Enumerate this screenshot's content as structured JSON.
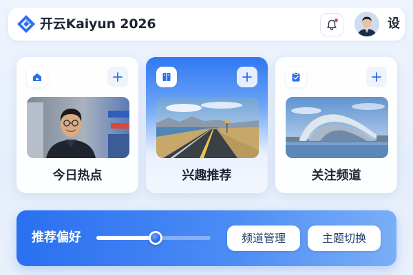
{
  "header": {
    "app_title": "开云Kaiyun 2026",
    "settings_label": "设",
    "notification_icon": "bell-icon",
    "logo_icon": "diamond-logo-icon"
  },
  "cards": [
    {
      "label": "今日热点",
      "icon": "home-icon",
      "add_icon": "plus-icon",
      "image": "portrait-photo",
      "active": false
    },
    {
      "label": "兴趣推荐",
      "icon": "book-icon",
      "add_icon": "plus-icon",
      "image": "coastal-road-photo",
      "active": true
    },
    {
      "label": "关注频道",
      "icon": "clipboard-icon",
      "add_icon": "plus-icon",
      "image": "architecture-photo",
      "active": false
    }
  ],
  "preferences": {
    "label": "推荐偏好",
    "slider_value": 0.52,
    "buttons": [
      "频道管理",
      "主题切换"
    ]
  },
  "colors": {
    "accent": "#2a6ff0",
    "background": "#eef4fd",
    "notification_dot": "#e0463d"
  }
}
